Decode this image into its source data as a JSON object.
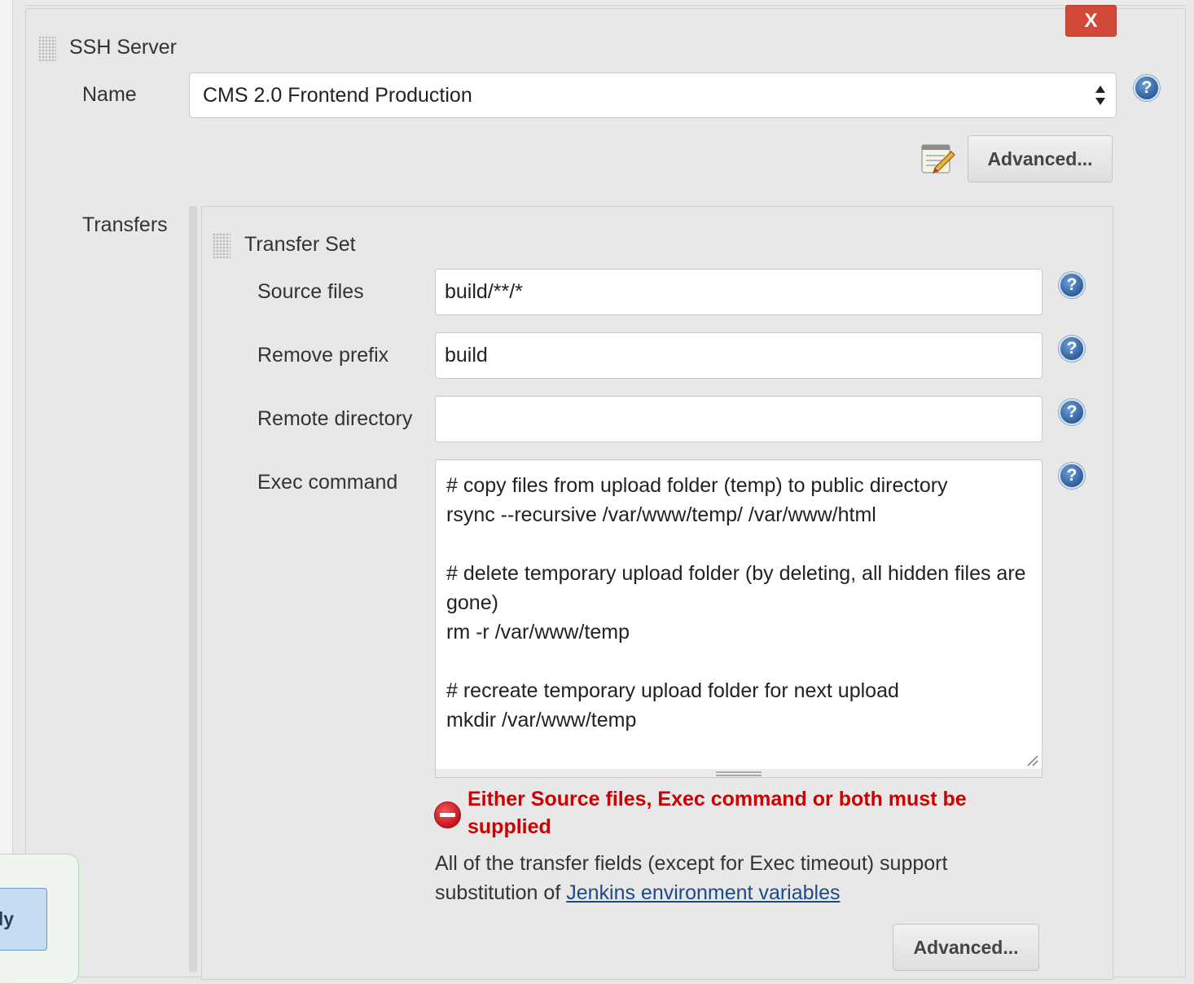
{
  "ssh_server": {
    "title": "SSH Server",
    "close_label": "X",
    "name_label": "Name",
    "name_value": "CMS 2.0 Frontend Production",
    "advanced_label": "Advanced..."
  },
  "transfers": {
    "label": "Transfers",
    "transfer_set": {
      "title": "Transfer Set",
      "source_files_label": "Source files",
      "source_files_value": "build/**/*",
      "remove_prefix_label": "Remove prefix",
      "remove_prefix_value": "build",
      "remote_directory_label": "Remote directory",
      "remote_directory_value": "",
      "exec_command_label": "Exec command",
      "exec_command_value": "# copy files from upload folder (temp) to public directory\nrsync --recursive /var/www/temp/ /var/www/html\n\n# delete temporary upload folder (by deleting, all hidden files are gone)\nrm -r /var/www/temp\n\n# recreate temporary upload folder for next upload\nmkdir /var/www/temp",
      "error_message": "Either Source files, Exec command or both must be supplied",
      "info_text": "All of the transfer fields (except for Exec timeout) support substitution of ",
      "info_link": "Jenkins environment variables",
      "advanced_label": "Advanced..."
    }
  },
  "help_icon_glyph": "?",
  "left_popup": {
    "button_label": "ly"
  },
  "colors": {
    "close_button": "#d24939",
    "error_text": "#cc0000",
    "link": "#204a87",
    "help_icon": "#2e5f9e"
  }
}
